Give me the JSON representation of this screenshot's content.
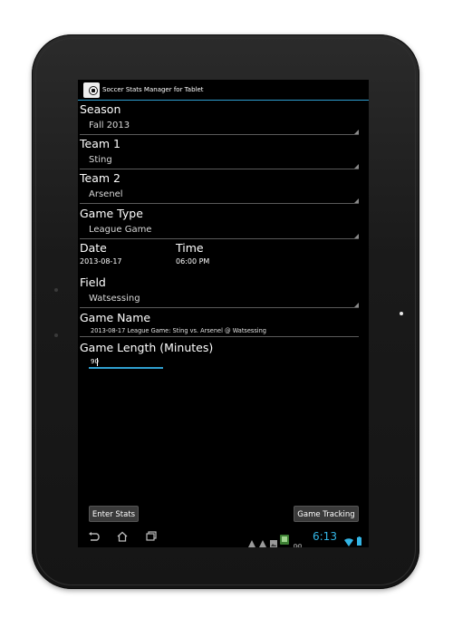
{
  "app": {
    "title": "Soccer Stats Manager for Tablet"
  },
  "form": {
    "season": {
      "label": "Season",
      "value": "Fall 2013"
    },
    "team1": {
      "label": "Team 1",
      "value": "Sting"
    },
    "team2": {
      "label": "Team 2",
      "value": "Arsenel"
    },
    "game_type": {
      "label": "Game Type",
      "value": "League Game"
    },
    "date": {
      "label": "Date",
      "value": "2013-08-17"
    },
    "time": {
      "label": "Time",
      "value": "06:00 PM"
    },
    "field": {
      "label": "Field",
      "value": "Watsessing"
    },
    "game_name": {
      "label": "Game Name",
      "value": "2013-08-17 League Game: Sting vs. Arsenel @ Watsessing"
    },
    "game_length": {
      "label": "Game Length (Minutes)",
      "value": "90"
    }
  },
  "buttons": {
    "enter_stats": "Enter Stats",
    "game_tracking": "Game Tracking"
  },
  "statusbar": {
    "clock": "6:13"
  },
  "colors": {
    "accent": "#33b5e5",
    "background": "#000000",
    "bezel": "#1c1c1c"
  },
  "icons": [
    "back-icon",
    "home-icon",
    "recent-apps-icon",
    "warning-icon",
    "image-icon",
    "app-notification-icon",
    "voicemail-icon",
    "wifi-icon",
    "battery-icon"
  ]
}
